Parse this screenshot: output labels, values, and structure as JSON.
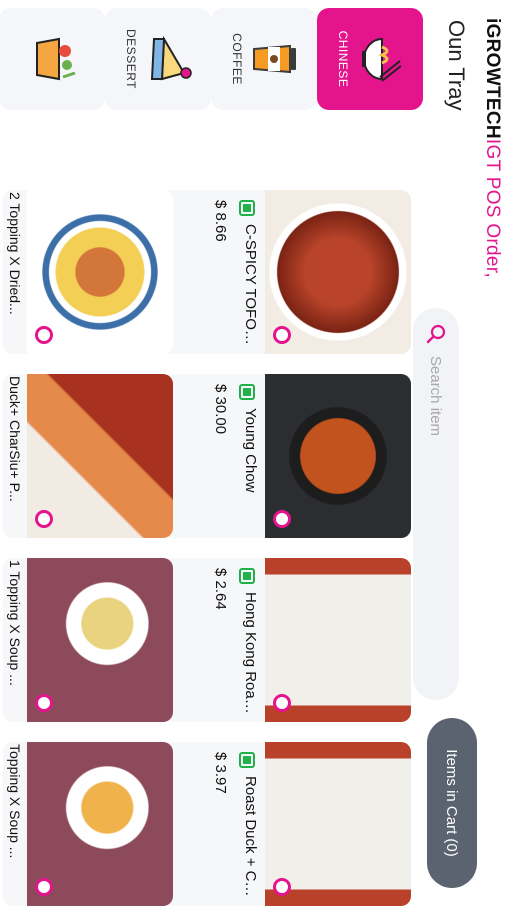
{
  "header": {
    "brand": "iGROWTECH",
    "title_pink": "IGT POS Order,",
    "subtitle": "Oun Tray"
  },
  "search": {
    "placeholder": "Search item"
  },
  "cart": {
    "label": "Items in Cart (0)"
  },
  "categories": [
    {
      "label": "CHINESE",
      "icon": "noodle-bowl-icon",
      "active": true
    },
    {
      "label": "COFFEE",
      "icon": "coffee-cup-icon",
      "active": false
    },
    {
      "label": "DESSERT",
      "icon": "cake-icon",
      "active": false
    },
    {
      "label": "",
      "icon": "gift-basket-icon",
      "active": false
    }
  ],
  "items_row1": [
    {
      "name": "C-SPICY TOFOO...",
      "price": "$ 8.66"
    },
    {
      "name": "Young Chow",
      "price": "$ 30.00"
    },
    {
      "name": "Hong Kong Roast ...",
      "price": "$ 2.64"
    },
    {
      "name": "Roast Duck + Cha...",
      "price": "$ 3.97"
    }
  ],
  "items_row2": [
    {
      "name": "2 Topping X Dried..."
    },
    {
      "name": "Duck+ CharSiu+ P..."
    },
    {
      "name": "1 Topping X Soup ..."
    },
    {
      "name": "Topping X Soup ..."
    }
  ],
  "colors": {
    "accent": "#e4148c",
    "veg": "#1fb24a",
    "cart_bg": "#5b6270"
  }
}
